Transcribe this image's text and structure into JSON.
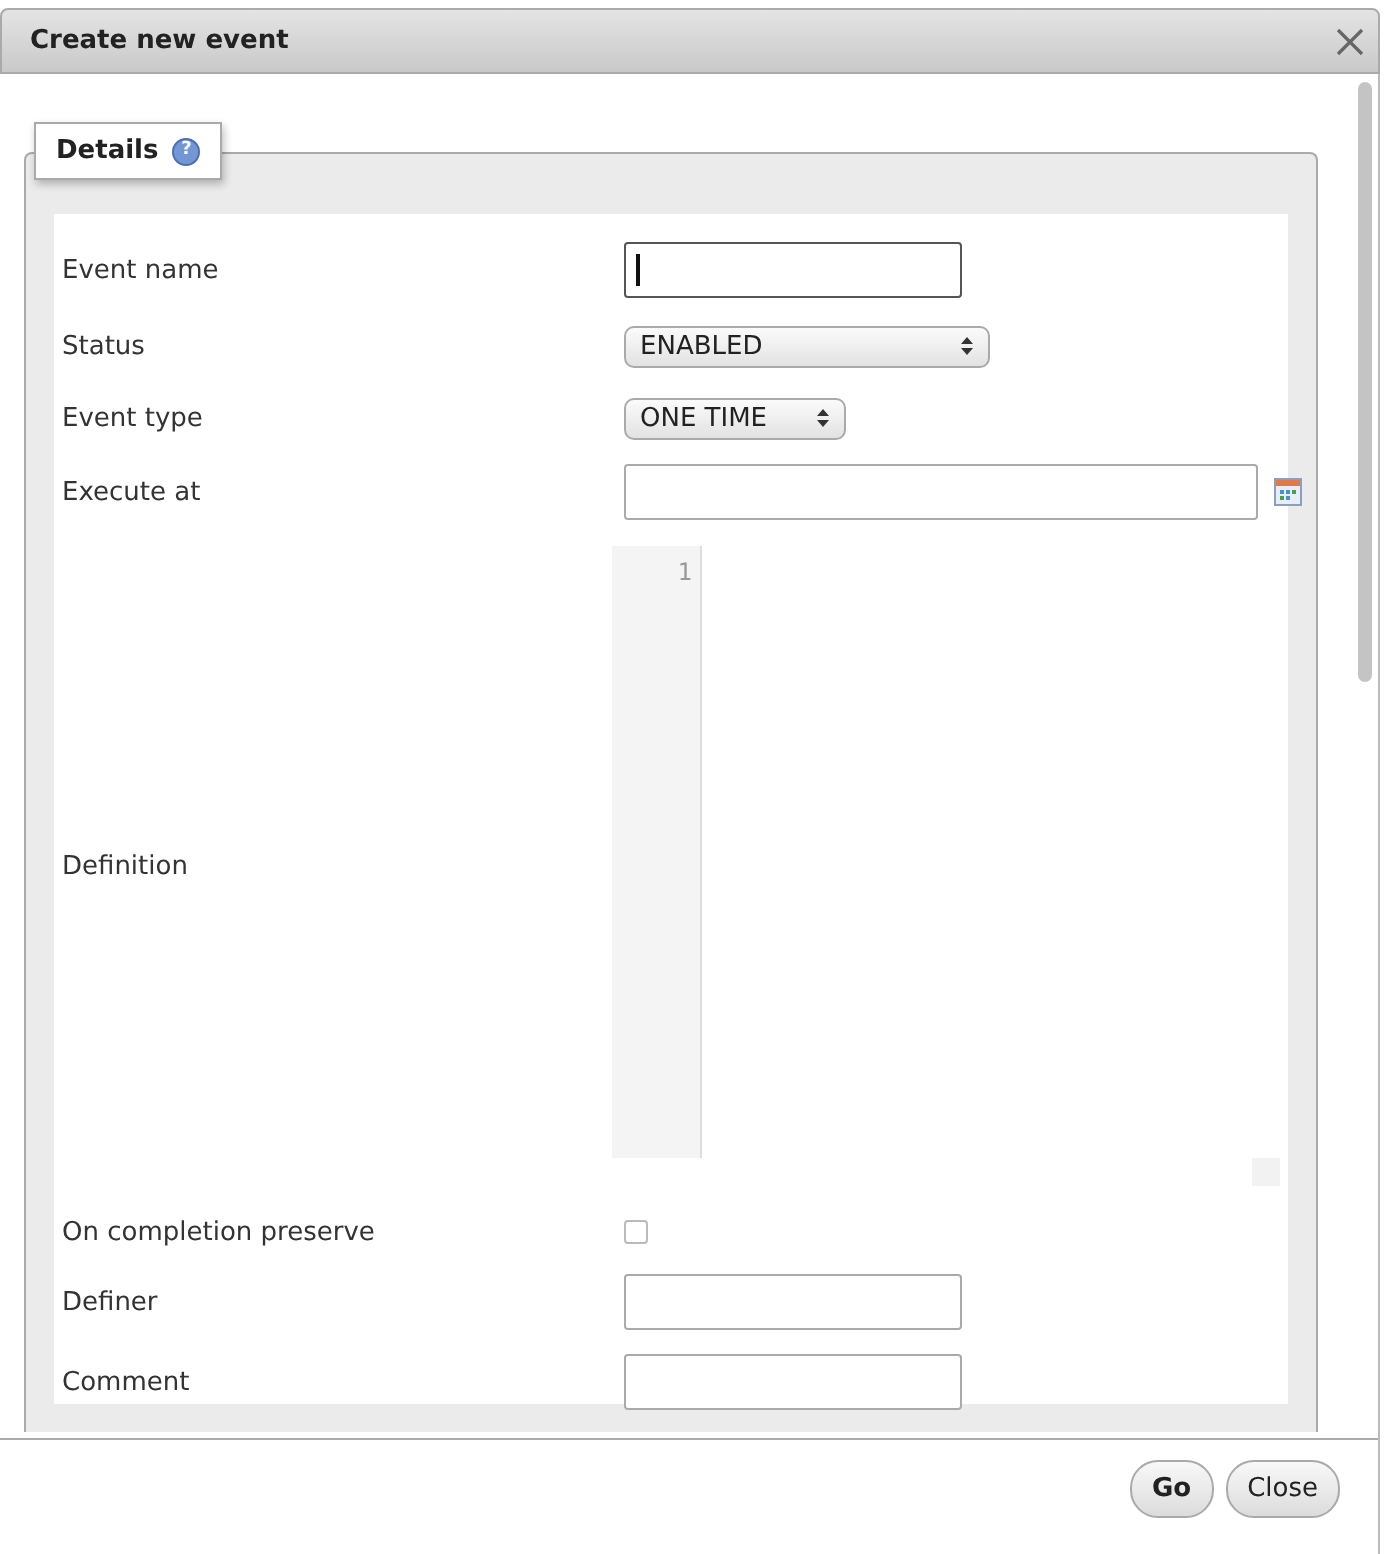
{
  "dialog": {
    "title": "Create new event"
  },
  "tab": {
    "label": "Details",
    "help": "?"
  },
  "fields": [
    {
      "label": "Event name",
      "kind": "text",
      "focused": true
    },
    {
      "label": "Status",
      "kind": "select",
      "value": "ENABLED"
    },
    {
      "label": "Event type",
      "kind": "select",
      "value": "ONE TIME"
    },
    {
      "label": "Execute at",
      "kind": "datetime"
    },
    {
      "label": "Definition",
      "kind": "code",
      "line_numbers": [
        "1"
      ]
    },
    {
      "label": "On completion preserve",
      "kind": "checkbox",
      "checked": false
    },
    {
      "label": "Definer",
      "kind": "text",
      "focused": false
    },
    {
      "label": "Comment",
      "kind": "text",
      "focused": false
    }
  ],
  "buttons": [
    {
      "label": "Go",
      "primary": true
    },
    {
      "label": "Close",
      "primary": false
    }
  ]
}
